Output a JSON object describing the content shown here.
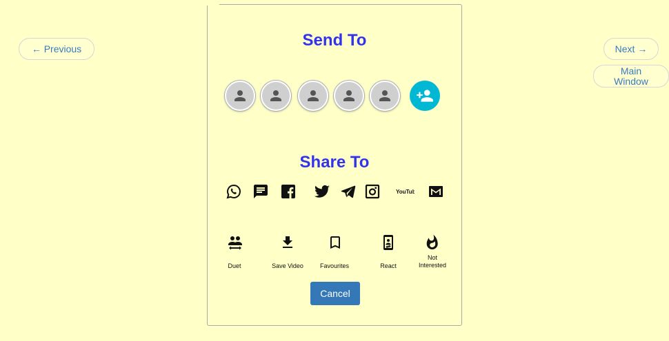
{
  "nav": {
    "previous_label": "← Previous",
    "next_label": "Next →",
    "main_window_label": "Main Window"
  },
  "send": {
    "title": "Send To",
    "contacts": [
      {
        "icon": "person-icon"
      },
      {
        "icon": "person-icon"
      },
      {
        "icon": "person-icon"
      },
      {
        "icon": "person-icon"
      },
      {
        "icon": "person-icon"
      }
    ],
    "add_icon": "person-add-icon"
  },
  "share": {
    "title": "Share To",
    "targets": [
      {
        "icon": "whatsapp-icon"
      },
      {
        "icon": "sms-message-icon"
      },
      {
        "icon": "facebook-icon"
      },
      {
        "icon": "twitter-icon"
      },
      {
        "icon": "telegram-icon"
      },
      {
        "icon": "instagram-icon"
      },
      {
        "icon": "youtube-icon",
        "text": "YouTube"
      },
      {
        "icon": "gmail-icon"
      }
    ]
  },
  "actions": [
    {
      "icon": "duet-icon",
      "label": "Duet"
    },
    {
      "icon": "download-icon",
      "label": "Save Video"
    },
    {
      "icon": "bookmark-icon",
      "label": "Favourites"
    },
    {
      "icon": "react-phone-icon",
      "label": "React"
    },
    {
      "icon": "fire-icon",
      "label": "Not Interested"
    }
  ],
  "cancel_label": "Cancel",
  "colors": {
    "background": "#ffffc8",
    "heading": "#3333ee",
    "add_contact": "#00b8d4",
    "cancel_button": "#3578b8",
    "link": "#3a7bbf"
  }
}
